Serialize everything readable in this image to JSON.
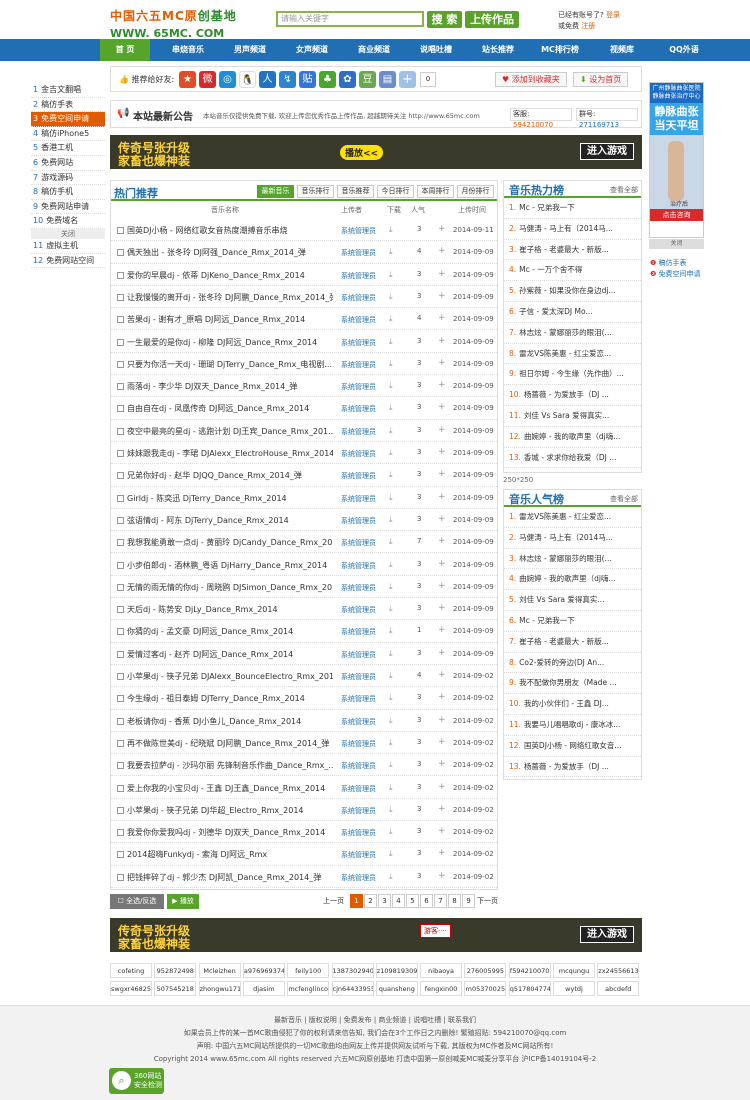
{
  "logo": {
    "line1_a": "中国六五MC原",
    "line1_b": "创基地",
    "line2": "WWW. 65MC. COM"
  },
  "search": {
    "placeholder": "请输入关键字",
    "button": "搜 索",
    "upload": "上传作品"
  },
  "login": {
    "line1": "已经有账号了?",
    "login_link": "登录",
    "line2": "或免费",
    "register_link": "注册"
  },
  "nav": [
    "首 页",
    "串烧音乐",
    "男声频道",
    "女声频道",
    "商业频道",
    "说唱吐槽",
    "站长推荐",
    "MC排行榜",
    "视频库",
    "QQ外语"
  ],
  "share": {
    "label": "推荐给好友:",
    "count": "0",
    "fav": "添加到收藏夹",
    "home": "设为首页"
  },
  "left_nav": [
    {
      "n": "1",
      "t": "金吉文翻唱"
    },
    {
      "n": "2",
      "t": "稿仿手表"
    },
    {
      "n": "3",
      "t": "免费空间申请"
    },
    {
      "n": "4",
      "t": "稿仿iPhone5"
    },
    {
      "n": "5",
      "t": "香港工机"
    },
    {
      "n": "6",
      "t": "免费网站"
    },
    {
      "n": "7",
      "t": "游戏源码"
    },
    {
      "n": "8",
      "t": "稿仿手机"
    },
    {
      "n": "9",
      "t": "免费网站申请"
    },
    {
      "n": "10",
      "t": "免费域名"
    },
    {
      "n": "11",
      "t": "虚拟主机"
    },
    {
      "n": "12",
      "t": "免费网站空间"
    }
  ],
  "left_nav_tag": "关闭",
  "notice": {
    "title": "本站最新公告",
    "text": "本站音乐仅提供免费下载, 欢迎上传您优秀作品上传作品, 超越期待关注 http://www.65mc.com",
    "kefu_label": "客服:",
    "kefu": "594210070",
    "qun_label": "群号:",
    "qun": "271169713"
  },
  "banner": {
    "t1": "传奇号张升级",
    "t2": "家畜也爆神装",
    "badge": "播放<<",
    "go": "进入游戏",
    "tip": "游客····"
  },
  "hot": {
    "title": "热门推荐",
    "tabs": [
      "最新音乐",
      "音乐排行",
      "音乐推荐",
      "今日排行",
      "本周排行",
      "月份排行"
    ],
    "cols": {
      "name": "音乐名称",
      "uploader": "上传者",
      "download": "下载",
      "pop": "人气",
      "time": "上传时间"
    },
    "rows": [
      {
        "name": "国英DJ小杨 - 网络红歌女音热度潮搏音乐串烧",
        "up": "系统管理员",
        "pop": "3",
        "date": "2014-09-11"
      },
      {
        "name": "偶天独出 - 张冬玲 DJ阿强_Dance_Rmx_2014_弹",
        "up": "系统管理员",
        "pop": "4",
        "date": "2014-09-09"
      },
      {
        "name": "爱你的早晨dj - 依蒂 DjKeno_Dance_Rmx_2014",
        "up": "系统管理员",
        "pop": "3",
        "date": "2014-09-09"
      },
      {
        "name": "让我慢慢的离开dj - 张冬玲 DJ阿鹏_Dance_Rmx_2014_弹",
        "up": "系统管理员",
        "pop": "3",
        "date": "2014-09-09"
      },
      {
        "name": "苦果dj - 谢有才_原唱 DJ阿远_Dance_Rmx_2014",
        "up": "系统管理员",
        "pop": "4",
        "date": "2014-09-09"
      },
      {
        "name": "一生最爱的是你dj - 柳隆 DJ阿远_Dance_Rmx_2014",
        "up": "系统管理员",
        "pop": "3",
        "date": "2014-09-09"
      },
      {
        "name": "只要为你活一天dj - 珊瑚 DjTerry_Dance_Rmx_电视剧...",
        "up": "系统管理员",
        "pop": "3",
        "date": "2014-09-09"
      },
      {
        "name": "雨落dj - 李少华 DJ双天_Dance_Rmx_2014_弹",
        "up": "系统管理员",
        "pop": "3",
        "date": "2014-09-09"
      },
      {
        "name": "自由自在dj - 凤凰传奇 DJ阿远_Dance_Rmx_2014",
        "up": "系统管理员",
        "pop": "3",
        "date": "2014-09-09"
      },
      {
        "name": "夜空中最亮的星dj - 逃跑计划 DJ王宾_Dance_Rmx_201...",
        "up": "系统管理员",
        "pop": "3",
        "date": "2014-09-09"
      },
      {
        "name": "妹妹跟我走dj - 李珺 DJAlexx_ElectroHouse_Rmx_2014",
        "up": "系统管理员",
        "pop": "3",
        "date": "2014-09-09"
      },
      {
        "name": "兄弟你好dj - 赵华 DJQQ_Dance_Rmx_2014_弹",
        "up": "系统管理员",
        "pop": "3",
        "date": "2014-09-09"
      },
      {
        "name": "Girldj - 陈奕迅 DjTerry_Dance_Rmx_2014",
        "up": "系统管理员",
        "pop": "3",
        "date": "2014-09-09"
      },
      {
        "name": "弦语情dj - 阿东 DjTerry_Dance_Rmx_2014",
        "up": "系统管理员",
        "pop": "3",
        "date": "2014-09-09"
      },
      {
        "name": "我想我能勇敢一点dj - 黄丽玲 DjCandy_Dance_Rmx_20...",
        "up": "系统管理员",
        "pop": "7",
        "date": "2014-09-09"
      },
      {
        "name": "小步伯郎dj - 酒林鹏_粤语 DjHarry_Dance_Rmx_2014",
        "up": "系统管理员",
        "pop": "3",
        "date": "2014-09-09"
      },
      {
        "name": "无情的雨无情的你dj - 周晓鸥 DJSimon_Dance_Rmx_20...",
        "up": "系统管理员",
        "pop": "3",
        "date": "2014-09-09"
      },
      {
        "name": "天后dj - 陈势安 DjLy_Dance_Rmx_2014",
        "up": "系统管理员",
        "pop": "3",
        "date": "2014-09-09"
      },
      {
        "name": "你猜的dj - 孟文豪 DJ阿远_Dance_Rmx_2014",
        "up": "系统管理员",
        "pop": "1",
        "date": "2014-09-09"
      },
      {
        "name": "爱情过客dj - 赵齐 DJ阿远_Dance_Rmx_2014",
        "up": "系统管理员",
        "pop": "3",
        "date": "2014-09-09"
      },
      {
        "name": "小苹果dj - 筷子兄弟 DJAlexx_BounceElectro_Rmx_2014",
        "up": "系统管理员",
        "pop": "4",
        "date": "2014-09-02"
      },
      {
        "name": "今生缘dj - 祖日泰姆 DJTerry_Dance_Rmx_2014",
        "up": "系统管理员",
        "pop": "3",
        "date": "2014-09-02"
      },
      {
        "name": "老板请你dj - 香蕉 DJ小鱼儿_Dance_Rmx_2014",
        "up": "系统管理员",
        "pop": "3",
        "date": "2014-09-02"
      },
      {
        "name": "再不做陈世美dj - 纪晓斌 DJ阿鹏_Dance_Rmx_2014_弹",
        "up": "系统管理员",
        "pop": "3",
        "date": "2014-09-02"
      },
      {
        "name": "我要去拉萨dj - 沙玛尔丽 先锋制音乐作曲_Dance_Rmx_...",
        "up": "系统管理员",
        "pop": "3",
        "date": "2014-09-02"
      },
      {
        "name": "爱上你我的小宝贝dj - 王鑫 DJ王鑫_Dance_Rmx_2014",
        "up": "系统管理员",
        "pop": "3",
        "date": "2014-09-02"
      },
      {
        "name": "小苹果dj - 筷子兄弟 DJ华超_Electro_Rmx_2014",
        "up": "系统管理员",
        "pop": "3",
        "date": "2014-09-02"
      },
      {
        "name": "我爱你你爱我吗dj - 刘德华 DJ双天_Dance_Rmx_2014",
        "up": "系统管理员",
        "pop": "3",
        "date": "2014-09-02"
      },
      {
        "name": "2014超嗨Funkydj - 索海 DJ阿远_Rmx",
        "up": "系统管理员",
        "pop": "3",
        "date": "2014-09-02"
      },
      {
        "name": "把钱摔碎了dj - 郭少杰 DJ阿凯_Dance_Rmx_2014_弹",
        "up": "系统管理员",
        "pop": "3",
        "date": "2014-09-02"
      }
    ]
  },
  "actions": {
    "select_all": "全选/反选",
    "play": "播放"
  },
  "pager": {
    "prev": "上一页",
    "pages": [
      "1",
      "2",
      "3",
      "4",
      "5",
      "6",
      "7",
      "8",
      "9"
    ],
    "next": "下一页"
  },
  "rank_hot": {
    "title": "音乐热力榜",
    "more": "查看全部",
    "items": [
      "Mc - 兄弟我一下",
      "马健涛 - 马上有（2014马...",
      "崔子格 - 老婆最大 - 新版...",
      "Mc - 一万个舍不得",
      "孙紫薇 - 如果没你在身边dj...",
      "子信 - 爱太深DJ Mo...",
      "林志炫 - 蒙娜丽莎的眼泪(...",
      "雷龙VS陈美惠 - 红尘爱恋...",
      "祖日尔姆 - 今生缘（先作曲）...",
      "杨蔷薇 - 为爱放手（DJ ...",
      "刘佳 Vs Sara 爱得真实...",
      "曲婉婷 - 我的歌声里（dj嗨...",
      "香城 - 求求你给我爱（DJ ..."
    ]
  },
  "ad_size": "250*250",
  "rank_pop": {
    "title": "音乐人气榜",
    "more": "查看全部",
    "items": [
      "雷龙VS陈美惠 - 红尘爱恋...",
      "马健涛 - 马上有（2014马...",
      "林志炫 - 蒙娜丽莎的眼泪(...",
      "曲婉婷 - 我的歌声里（dj嗨...",
      "刘佳 Vs Sara 爱得真实...",
      "Mc - 兄弟我一下",
      "崔子格 - 老婆最大 - 新版...",
      "Co2-爱转的旁边(DJ An...",
      "我不配做你男朋友（Made ...",
      "我的小伙伴们 - 王鑫 DJ...",
      "我要马儿唱唱歌dj - 康冰冰...",
      "国英DJ小杨 - 网络红歌女音...",
      "杨蔷薇 - 为爱放手（DJ ..."
    ]
  },
  "right_ad": {
    "top": "广州静脉曲张医院 静脉曲张治疗中心",
    "big1": "静脉曲张",
    "big2": "当天平坦",
    "cap": "治疗后",
    "btn": "点击咨询",
    "close": "关闭",
    "links": [
      "稿仿手表",
      "免费空间申请"
    ]
  },
  "friends": {
    "row1": [
      "cofeting",
      "952872498",
      "Mcleizhen",
      "a976969374",
      "feily100",
      "1387302940",
      "z109819309",
      "nibaoya",
      "276005995",
      "f594210070",
      "mcqungu",
      "zx24556613"
    ],
    "row2": [
      "swgxr46825",
      "507545218",
      "zhongwu171",
      "djasim",
      "mcfenglinco",
      "cjn64433955",
      "quansheng",
      "fengxin00",
      "m05370025",
      "q517804774",
      "wytdj",
      "abcdefd"
    ]
  },
  "footer": {
    "links": [
      "最新音乐",
      "版权说明",
      "免费发布",
      "商业频道",
      "说唱吐槽",
      "联系我们"
    ],
    "l2": "如果会员上传的某一首MC歌曲侵犯了你的权利请来信告知, 我们会在3个工作日之内删除! 繁殖招贴: 594210070@qq.com",
    "l3": "声明: 中国六五MC网站所提供的一切MC歌曲均由网友上传并提供网友试听与下载, 其版权为MC作者及MC网站所有!",
    "l4": "Copyright 2014 www.65mc.com All rights reserved 六五MC网原创基地 打造中国第一原创喊麦MC喊麦分享平台 沪ICP备14019104号-2",
    "secure_a": "360网站",
    "secure_b": "安全检测"
  }
}
